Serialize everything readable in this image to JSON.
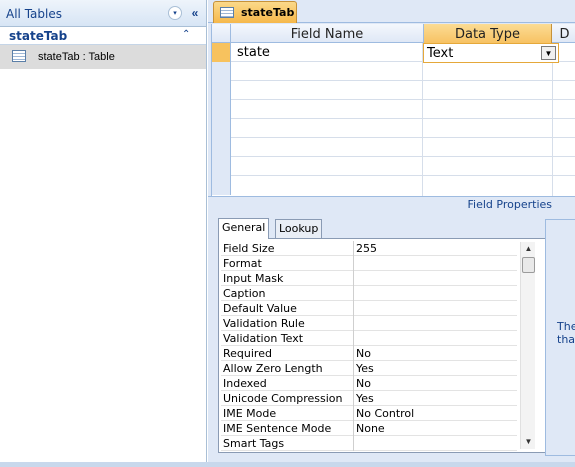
{
  "nav": {
    "title": "All Tables",
    "dropdown_glyph": "▾",
    "collapse_glyph": "«",
    "group": {
      "title": "stateTab",
      "chevron": "⌃"
    },
    "items": [
      {
        "label": "stateTab : Table",
        "icon": "table-icon"
      }
    ]
  },
  "doc_tab": {
    "label": "stateTab",
    "icon": "table-icon"
  },
  "grid": {
    "headers": {
      "field_name": "Field Name",
      "data_type": "Data Type",
      "description": "D"
    },
    "rows": [
      {
        "field_name": "state",
        "data_type": "Text"
      }
    ],
    "dropdown_glyph": "▼"
  },
  "field_properties": {
    "title": "Field Properties",
    "tabs": [
      "General",
      "Lookup"
    ],
    "properties": [
      {
        "label": "Field Size",
        "value": "255"
      },
      {
        "label": "Format",
        "value": ""
      },
      {
        "label": "Input Mask",
        "value": ""
      },
      {
        "label": "Caption",
        "value": ""
      },
      {
        "label": "Default Value",
        "value": ""
      },
      {
        "label": "Validation Rule",
        "value": ""
      },
      {
        "label": "Validation Text",
        "value": ""
      },
      {
        "label": "Required",
        "value": "No"
      },
      {
        "label": "Allow Zero Length",
        "value": "Yes"
      },
      {
        "label": "Indexed",
        "value": "No"
      },
      {
        "label": "Unicode Compression",
        "value": "Yes"
      },
      {
        "label": "IME Mode",
        "value": "No Control"
      },
      {
        "label": "IME Sentence Mode",
        "value": "None"
      },
      {
        "label": "Smart Tags",
        "value": ""
      }
    ],
    "help_text_line1": "The",
    "help_text_line2": "that"
  },
  "colors": {
    "accent": "#f7c25e",
    "nav_text": "#15428b",
    "pane_bg": "#dfe8f6"
  }
}
